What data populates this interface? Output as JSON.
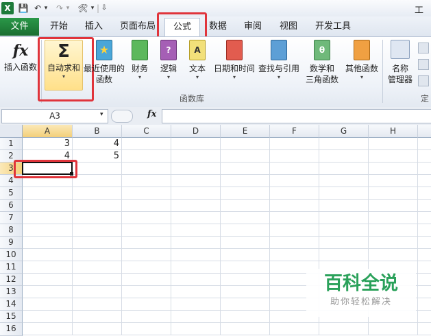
{
  "window_title": "工作",
  "app_icon_letter": "X",
  "quick_access": [
    "💾",
    "↶",
    "▾",
    "↷",
    "▾",
    "🛠",
    "▾",
    "|",
    "⇩"
  ],
  "tabs": [
    "文件",
    "开始",
    "插入",
    "页面布局",
    "公式",
    "数据",
    "审阅",
    "视图",
    "开发工具"
  ],
  "ribbon": {
    "insert_function": "插入函数",
    "autosum": "自动求和",
    "recent_line1": "最近使用的",
    "recent_line2": "函数",
    "finance": "财务",
    "logic": "逻辑",
    "text": "文本",
    "datetime": "日期和时间",
    "lookup": "查找与引用",
    "math_line1": "数学和",
    "math_line2": "三角函数",
    "other": "其他函数",
    "name_mgr_line1": "名称",
    "name_mgr_line2": "管理器",
    "group_label": "函数库",
    "right_group_label": "定",
    "icon_fx": "fx",
    "icon_sigma": "Σ",
    "icon_theta": "θ",
    "icon_a": "A",
    "icon_q": "?",
    "icon_star": "★"
  },
  "formula_bar": {
    "name_box": "A3",
    "fx": "fx",
    "value": ""
  },
  "grid": {
    "columns": [
      "A",
      "B",
      "C",
      "D",
      "E",
      "F",
      "G",
      "H"
    ],
    "rows": [
      "1",
      "2",
      "3",
      "4",
      "5",
      "6",
      "7",
      "8",
      "9",
      "10",
      "11",
      "12",
      "13",
      "14",
      "15",
      "16"
    ],
    "cells": {
      "A1": "3",
      "B1": "4",
      "A2": "4",
      "B2": "5"
    },
    "active_cell": "A3"
  },
  "watermark": {
    "title": "百科全说",
    "subtitle": "助你轻松解决"
  },
  "colors": {
    "accent_green": "#1d7a3a",
    "highlight_red": "#e0343b",
    "watermark_green": "#2aa15a"
  }
}
